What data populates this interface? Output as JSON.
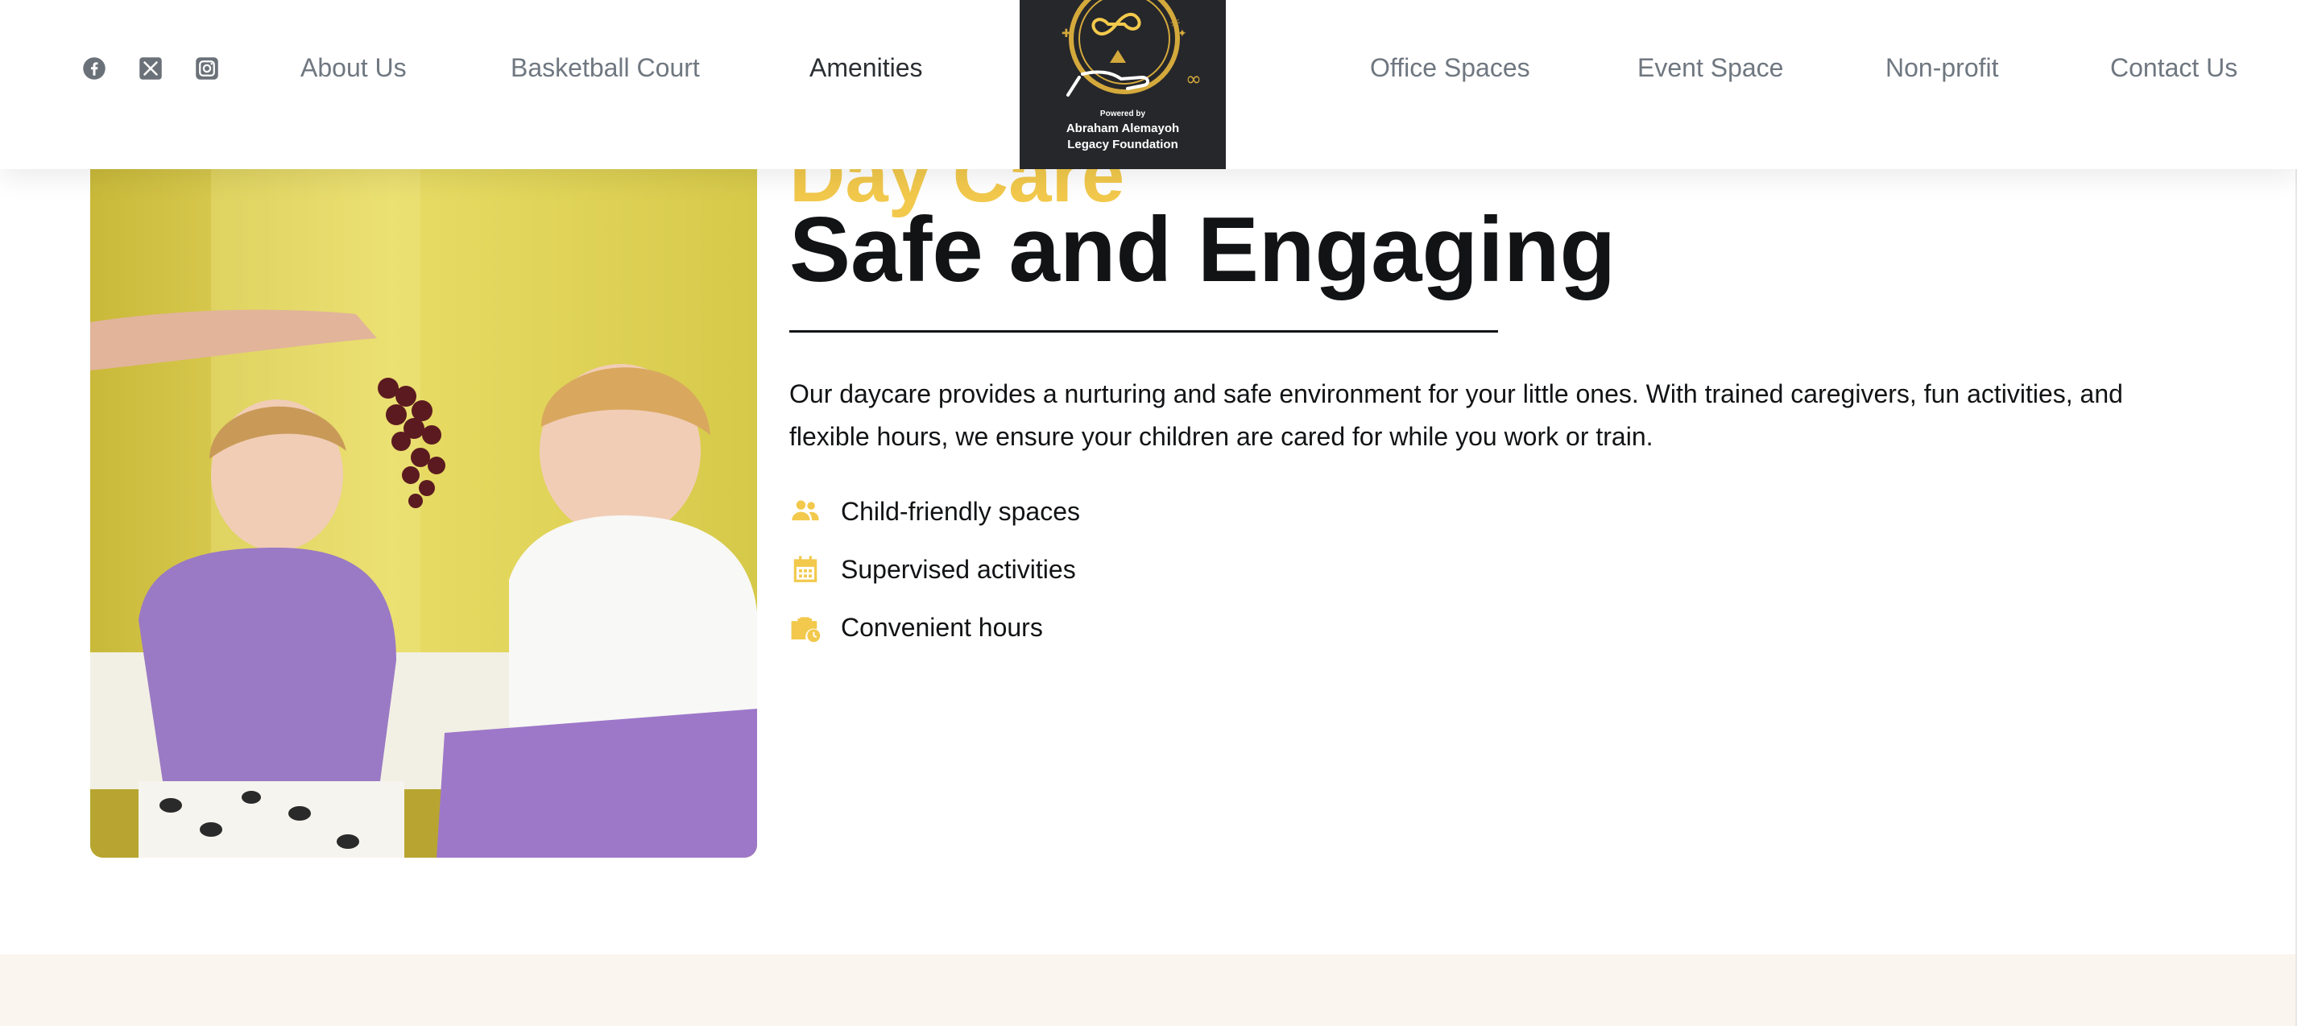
{
  "header": {
    "social": [
      {
        "name": "facebook",
        "icon": "facebook-icon"
      },
      {
        "name": "x",
        "icon": "x-icon"
      },
      {
        "name": "instagram",
        "icon": "instagram-icon"
      }
    ],
    "nav_left": [
      {
        "label": "About Us"
      },
      {
        "label": "Basketball Court"
      },
      {
        "label": "Amenities",
        "active": true
      }
    ],
    "nav_right": [
      {
        "label": "Office Spaces"
      },
      {
        "label": "Event Space"
      },
      {
        "label": "Non-profit"
      },
      {
        "label": "Contact Us"
      }
    ],
    "logo": {
      "powered_by": "Powered by",
      "name_line1": "Abraham Alemayoh",
      "name_line2": "Legacy Foundation"
    }
  },
  "section": {
    "eyebrow": "Day Care",
    "title": "Safe and Engaging",
    "description": "Our daycare provides a nurturing and safe environment for your little ones. With trained caregivers, fun activities, and flexible hours, we ensure your children are cared for while you work or train.",
    "features": [
      {
        "icon": "users-icon",
        "label": "Child-friendly spaces"
      },
      {
        "icon": "calendar-icon",
        "label": "Supervised activities"
      },
      {
        "icon": "briefcase-clock-icon",
        "label": "Convenient hours"
      }
    ]
  },
  "colors": {
    "accent": "#f2c94c",
    "text": "#111315",
    "nav_text": "#6f7780",
    "footer_band": "#faf5ee",
    "logo_bg": "#26272b"
  }
}
